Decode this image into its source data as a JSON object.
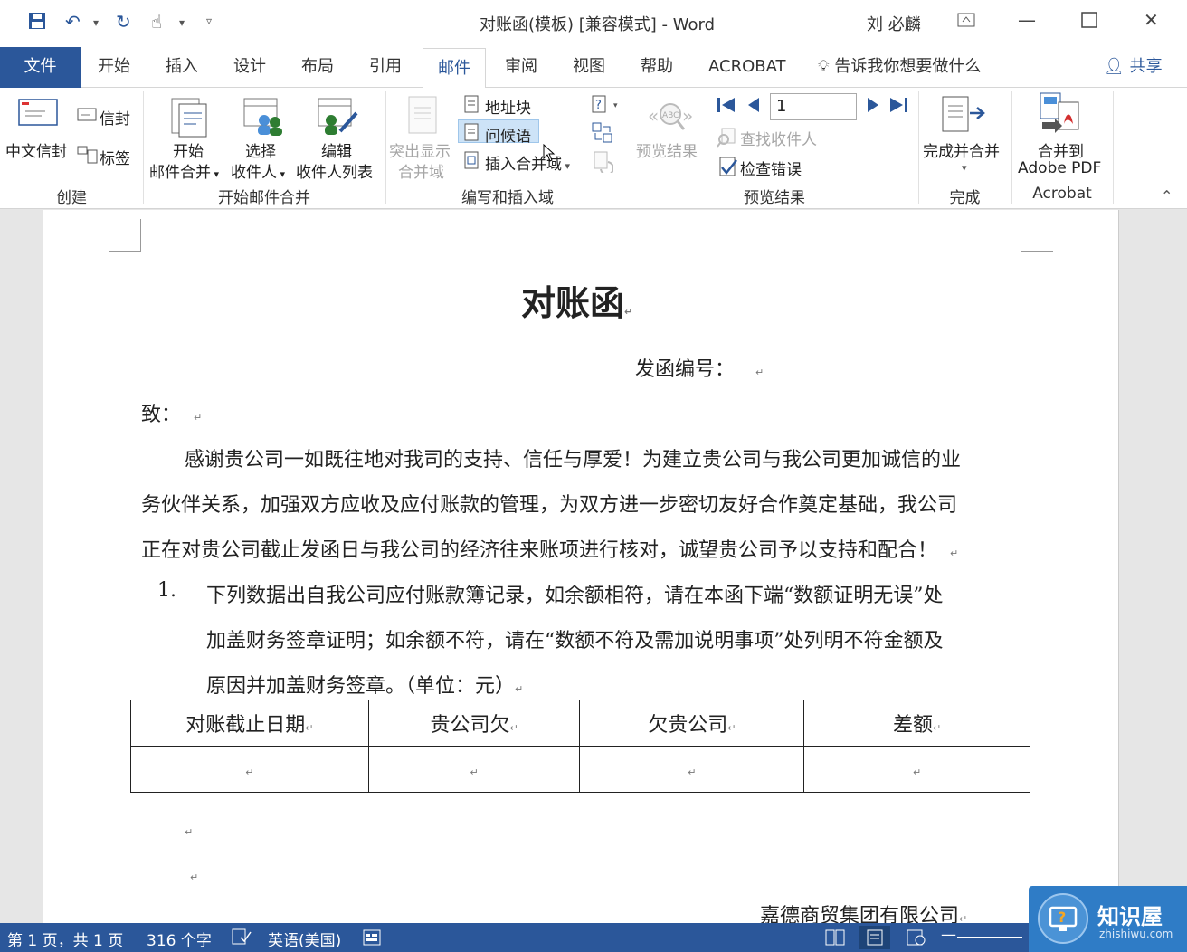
{
  "window": {
    "title": "对账函(模板) [兼容模式]  -  Word",
    "user": "刘 必麟"
  },
  "tabs": {
    "file": "文件",
    "items": [
      "开始",
      "插入",
      "设计",
      "布局",
      "引用",
      "邮件",
      "审阅",
      "视图",
      "帮助",
      "ACROBAT"
    ],
    "active": "邮件",
    "tell_me": "告诉我你想要做什么",
    "share": "共享"
  },
  "ribbon": {
    "create": {
      "label": "创建",
      "chinese_envelope": "中文信封",
      "envelope": "信封",
      "labels": "标签"
    },
    "start_merge": {
      "label": "开始邮件合并",
      "start_line1": "开始",
      "start_line2": "邮件合并",
      "select_line1": "选择",
      "select_line2": "收件人",
      "edit_line1": "编辑",
      "edit_line2": "收件人列表"
    },
    "write_insert": {
      "label": "编写和插入域",
      "highlight_line1": "突出显示",
      "highlight_line2": "合并域",
      "address_block": "地址块",
      "greeting_line": "问候语",
      "insert_merge_field": "插入合并域"
    },
    "preview": {
      "label": "预览结果",
      "preview_results": "预览结果",
      "record_number": "1",
      "find_recipient": "查找收件人",
      "check_errors": "检查错误"
    },
    "finish": {
      "label": "完成",
      "finish_merge": "完成并合并"
    },
    "acrobat": {
      "label": "Acrobat",
      "merge_line1": "合并到",
      "merge_line2": "Adobe PDF"
    }
  },
  "document": {
    "title": "对账函",
    "ref_no": "发函编号：",
    "to": "致：",
    "para1_line1": "感谢贵公司一如既往地对我司的支持、信任与厚爱！为建立贵公司与我公司更加诚信的业",
    "para1_line2": "务伙伴关系，加强双方应收及应付账款的管理，为双方进一步密切友好合作奠定基础，我公司",
    "para1_line3": "正在对贵公司截止发函日与我公司的经济往来账项进行核对，诚望贵公司予以支持和配合！",
    "item_number": "1.",
    "item_line1": "下列数据出自我公司应付账款簿记录，如余额相符，请在本函下端“数额证明无误”处",
    "item_line2": "加盖财务签章证明；如余额不符，请在“数额不符及需加说明事项”处列明不符金额及",
    "item_line3": "原因并加盖财务签章。（单位：元）",
    "table_headers": [
      "对账截止日期",
      "贵公司欠",
      "欠贵公司",
      "差额"
    ],
    "signature": "嘉德商贸集团有限公司"
  },
  "status": {
    "page": "第 1 页，共 1 页",
    "words": "316 个字",
    "language": "英语(美国)"
  },
  "watermark": {
    "name": "知识屋",
    "url": "zhishiwu.com"
  }
}
